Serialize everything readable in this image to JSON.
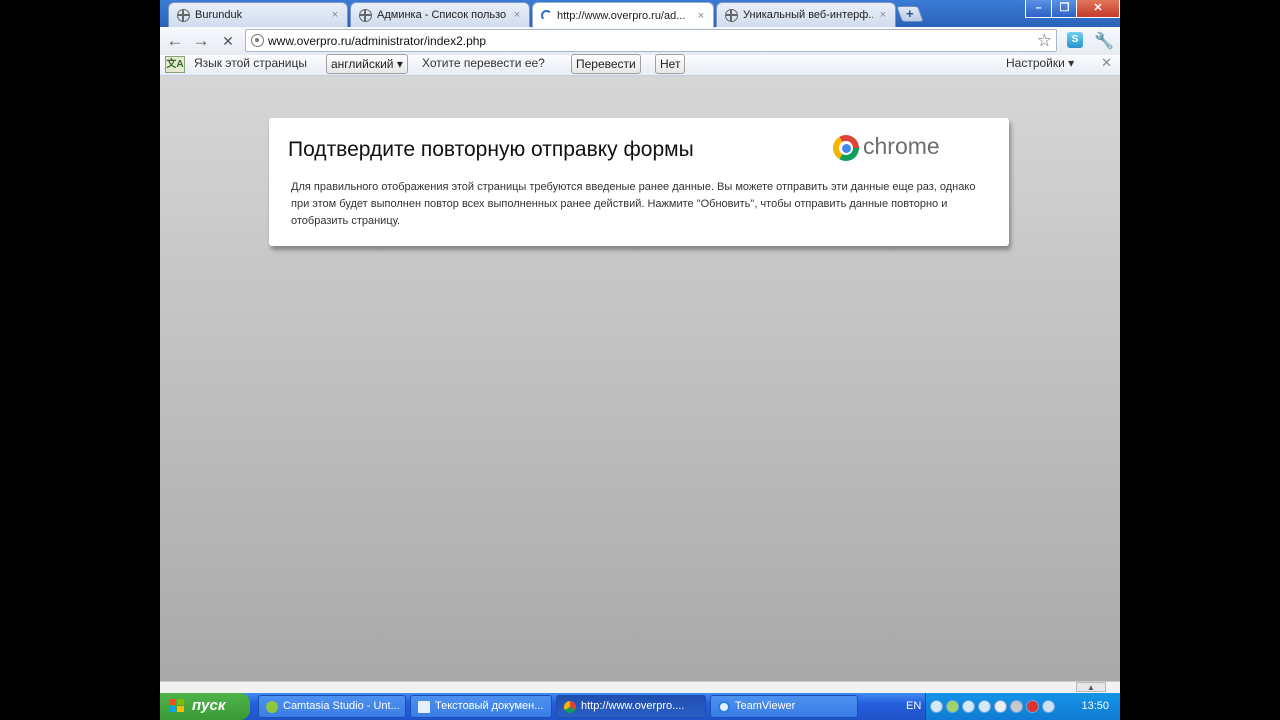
{
  "tabs": [
    {
      "title": "Burunduk",
      "close": "×"
    },
    {
      "title": "Админка - Список пользо...",
      "close": "×"
    },
    {
      "title": "http://www.overpro.ru/ad...",
      "close": "×"
    },
    {
      "title": "Уникальный веб-интерф...",
      "close": "×"
    }
  ],
  "newtab_label": "+",
  "window": {
    "minimize": "–",
    "maximize": "❐",
    "close": "✕"
  },
  "toolbar": {
    "back": "←",
    "forward": "→",
    "stop": "✕",
    "url": "www.overpro.ru/administrator/index2.php",
    "star": "☆",
    "ext": "S",
    "wrench": "🔧"
  },
  "infobar": {
    "icon": "文A",
    "prompt": "Язык этой страницы",
    "language": "английский ▾",
    "question": "Хотите перевести ее?",
    "translate": "Перевести",
    "no": "Нет",
    "settings": "Настройки ▾",
    "close": "✕"
  },
  "dialog": {
    "title": "Подтвердите повторную отправку формы",
    "brand": "chrome",
    "text": "Для правильного отображения этой страницы требуются введеные ранее данные. Вы можете отправить эти данные еще раз, однако при этом будет выполнен повтор всех выполненных ранее действий. Нажмите \"Обновить\", чтобы отправить данные повторно и отобразить страницу."
  },
  "scroll_up": "▲",
  "taskbar": {
    "start": "пуск",
    "items": [
      {
        "label": "Camtasia Studio - Unt..."
      },
      {
        "label": "Текстовый докумен..."
      },
      {
        "label": "http://www.overpro...."
      },
      {
        "label": "TeamViewer"
      }
    ],
    "lang": "EN",
    "clock": "13:50"
  },
  "colors": {
    "xp_blue": "#245edb",
    "start_green": "#3a9a36",
    "chrome_red": "#db4437",
    "chrome_green": "#0f9d58",
    "chrome_yellow": "#f4b400",
    "chrome_blue": "#4285f4"
  }
}
